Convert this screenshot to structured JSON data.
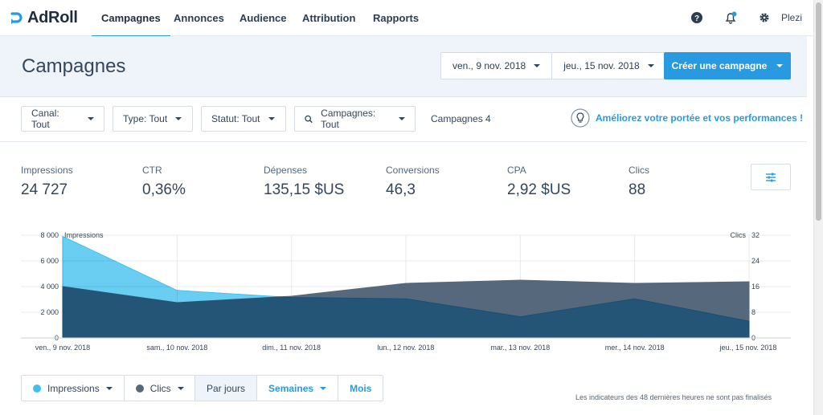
{
  "nav": {
    "brand": "AdRoll",
    "items": [
      {
        "label": "Campagnes",
        "active": true
      },
      {
        "label": "Annonces",
        "active": false
      },
      {
        "label": "Audience",
        "active": false
      },
      {
        "label": "Attribution",
        "active": false
      },
      {
        "label": "Rapports",
        "active": false
      }
    ],
    "icons": [
      "help-icon",
      "notification-bell-icon",
      "gear-icon"
    ],
    "user": "Plezi",
    "accent_color": "#2a9ae0"
  },
  "header": {
    "title": "Campagnes",
    "date_start": "ven., 9 nov. 2018",
    "date_end": "jeu., 15 nov. 2018",
    "create_button": "Créer une campagne"
  },
  "filters": {
    "canal": "Canal: Tout",
    "type": "Type: Tout",
    "statut": "Statut: Tout",
    "campagnes": "Campagnes: Tout",
    "count": "Campagnes 4",
    "improve_link": "Améliorez votre portée et vos performances !"
  },
  "metrics": [
    {
      "label": "Impressions",
      "value": "24 727"
    },
    {
      "label": "CTR",
      "value": "0,36%"
    },
    {
      "label": "Dépenses",
      "value": "135,15 $US"
    },
    {
      "label": "Conversions",
      "value": "46,3"
    },
    {
      "label": "CPA",
      "value": "2,92 $US"
    },
    {
      "label": "Clics",
      "value": "88"
    }
  ],
  "chart_data": {
    "type": "area",
    "x": [
      "ven., 9 nov. 2018",
      "sam., 10 nov. 2018",
      "dim., 11 nov. 2018",
      "lun., 12 nov. 2018",
      "mar., 13 nov. 2018",
      "mer., 14 nov. 2018",
      "jeu., 15 nov. 2018"
    ],
    "left_axis": {
      "label": "Impressions",
      "ticks": [
        "0",
        "2 000",
        "4 000",
        "6 000",
        "8 000"
      ],
      "range": [
        0,
        8000
      ]
    },
    "right_axis": {
      "label": "Clics",
      "ticks": [
        "0",
        "8",
        "16",
        "24",
        "32"
      ],
      "range": [
        0,
        32
      ]
    },
    "series": [
      {
        "name": "Impressions",
        "axis": "left",
        "color": "#40c0ee",
        "values": [
          7900,
          3700,
          3150,
          3050,
          1650,
          3050,
          1300
        ]
      },
      {
        "name": "Clics",
        "axis": "right",
        "color": "#56697c",
        "values": [
          16,
          11,
          13,
          17,
          18,
          17,
          17.5
        ]
      }
    ],
    "grid": true
  },
  "controls": {
    "series_impressions": "Impressions",
    "series_clics": "Clics",
    "by_day": "Par jours",
    "by_week": "Semaines",
    "by_month": "Mois",
    "footnote": "Les indicateurs des 48 dernières heures ne sont pas finalisés"
  }
}
